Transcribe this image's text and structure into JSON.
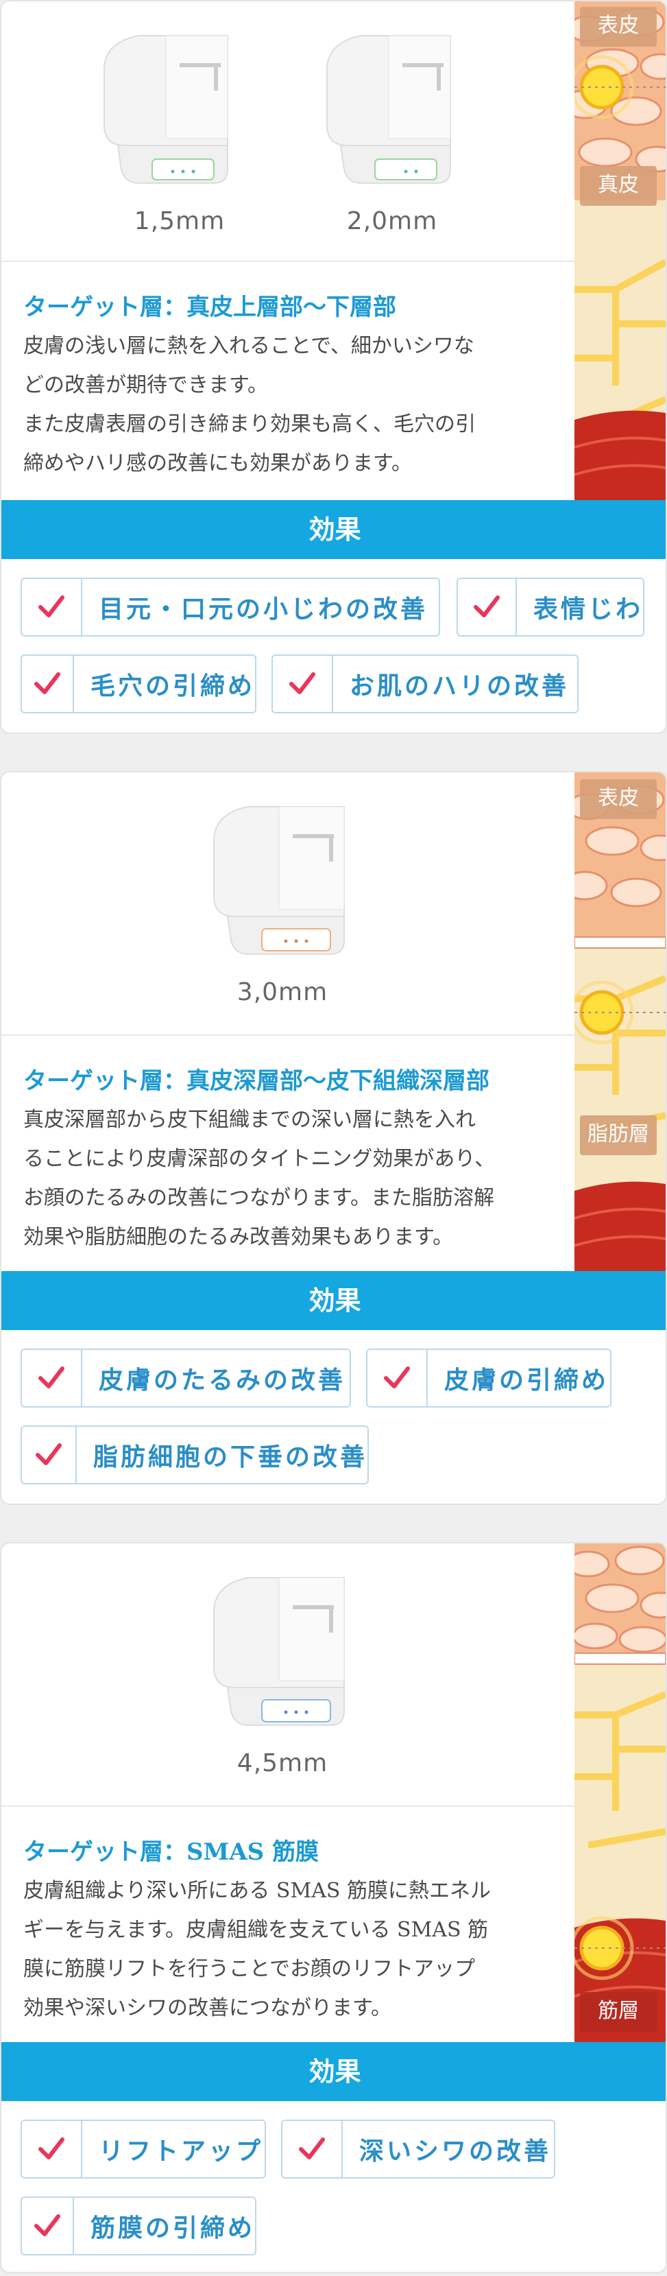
{
  "colors": {
    "accent": "#14a7e0",
    "target_text": "#1c9ad3",
    "tag_text": "#2a8ec8",
    "check": "#e8365a"
  },
  "cards": [
    {
      "sizes": [
        "1,5mm",
        "2,0mm"
      ],
      "skin_labels": [
        "表皮",
        "真皮"
      ],
      "target": "ターゲット層：真皮上層部〜下層部",
      "desc": [
        "皮膚の浅い層に熱を入れることで、細かいシワな",
        "どの改善が期待できます。",
        "また皮膚表層の引き締まり効果も高く、毛穴の引",
        "締めやハリ感の改善にも効果があります。"
      ],
      "effect_label": "効果",
      "effects": [
        "目元・口元の小じわの改善",
        "表情じわ",
        "毛穴の引締め",
        "お肌のハリの改善"
      ]
    },
    {
      "sizes": [
        "3,0mm"
      ],
      "skin_labels": [
        "表皮",
        "脂肪層"
      ],
      "target": "ターゲット層：真皮深層部〜皮下組織深層部",
      "desc": [
        "真皮深層部から皮下組織までの深い層に熱を入れ",
        "ることにより皮膚深部のタイトニング効果があり、",
        "お顔のたるみの改善につながります。また脂肪溶解",
        "効果や脂肪細胞のたるみ改善効果もあります。"
      ],
      "effect_label": "効果",
      "effects": [
        "皮膚のたるみの改善",
        "皮膚の引締め",
        "脂肪細胞の下垂の改善"
      ]
    },
    {
      "sizes": [
        "4,5mm"
      ],
      "skin_labels": [
        "筋層"
      ],
      "target": "ターゲット層：SMAS 筋膜",
      "desc": [
        "皮膚組織より深い所にある SMAS 筋膜に熱エネル",
        "ギーを与えます。皮膚組織を支えている SMAS 筋",
        "膜に筋膜リフトを行うことでお顔のリフトアップ",
        "効果や深いシワの改善につながります。"
      ],
      "effect_label": "効果",
      "effects": [
        "リフトアップ",
        "深いシワの改善",
        "筋膜の引締め"
      ]
    }
  ]
}
